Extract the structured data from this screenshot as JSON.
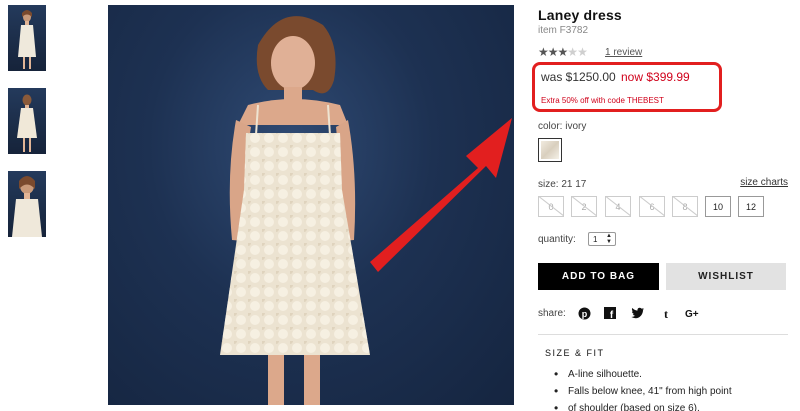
{
  "thumbnails": [
    {
      "alt": "front view thumbnail"
    },
    {
      "alt": "back view thumbnail"
    },
    {
      "alt": "close-up thumbnail"
    }
  ],
  "product": {
    "title": "Laney dress",
    "item_code": "item F3782",
    "rating": 3,
    "rating_max": 5,
    "review_link": "1 review",
    "price_was": "was $1250.00",
    "price_now": "now $399.99",
    "promo": "Extra 50% off with code THEBEST",
    "color_label": "color:",
    "color_value": "ivory",
    "size_label": "size:",
    "size_values": "21 17",
    "size_charts": "size charts",
    "sizes": [
      {
        "label": "0",
        "available": false
      },
      {
        "label": "2",
        "available": false
      },
      {
        "label": "4",
        "available": false
      },
      {
        "label": "6",
        "available": false
      },
      {
        "label": "8",
        "available": false
      },
      {
        "label": "10",
        "available": true
      },
      {
        "label": "12",
        "available": true
      }
    ],
    "quantity_label": "quantity:",
    "quantity_value": "1",
    "add_to_bag": "ADD TO BAG",
    "wishlist": "WISHLIST",
    "share_label": "share:",
    "social_icons": [
      "pinterest-icon",
      "facebook-icon",
      "twitter-icon",
      "tumblr-icon",
      "google-plus-icon"
    ],
    "size_fit": {
      "heading": "SIZE & FIT",
      "bullets": [
        "A-line silhouette.",
        "Falls below knee, 41\" from high point",
        "of shoulder (based on size 6)."
      ]
    }
  },
  "colors": {
    "accent_red": "#e21f1f",
    "price_red": "#d0021b",
    "bag_button": "#000000",
    "wishlist_button": "#e2e2e2"
  }
}
